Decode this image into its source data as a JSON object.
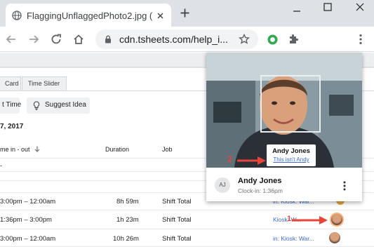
{
  "browser": {
    "tab_title": "FlaggingUnflaggedPhoto2.jpg (5",
    "new_tab_icon": "plus-icon",
    "url": "cdn.tsheets.com/help_i...",
    "window_controls": [
      "minimize-icon",
      "maximize-icon",
      "close-icon"
    ]
  },
  "page": {
    "tabs": [
      "Card",
      "Time Slider"
    ],
    "buttons": {
      "time_partial": "t Time",
      "suggest_idea": "Suggest Idea"
    },
    "date": "7, 2017",
    "columns": {
      "time_in_out": "me in - out",
      "duration": "Duration",
      "job": "Job"
    },
    "group_placeholder": "-",
    "rows": [
      {
        "time": "3:00pm  –  12:00am",
        "duration": "8h 59m",
        "job": "Shift Total",
        "location": "in: Kiosk: War...",
        "partial": true
      },
      {
        "time": "1:36pm  –   3:00pm",
        "duration": "1h 23m",
        "job": "Shift Total",
        "location": "Kiosk: W...",
        "partial": false
      },
      {
        "time": "3:00pm  –  12:00am",
        "duration": "10h 26m",
        "job": "Shift Total",
        "location": "in: Kiosk: War...",
        "partial": false
      }
    ]
  },
  "popup": {
    "face_name": "Andy Jones",
    "not_person_link": "This isn't Andy",
    "initials": "AJ",
    "person_name": "Andy Jones",
    "clock_in": "Clock-in: 1:36pm",
    "more_icon": "more-vert-icon"
  },
  "annotations": {
    "step2": "2",
    "step1": "1",
    "arrow_color": "#e8443a"
  }
}
